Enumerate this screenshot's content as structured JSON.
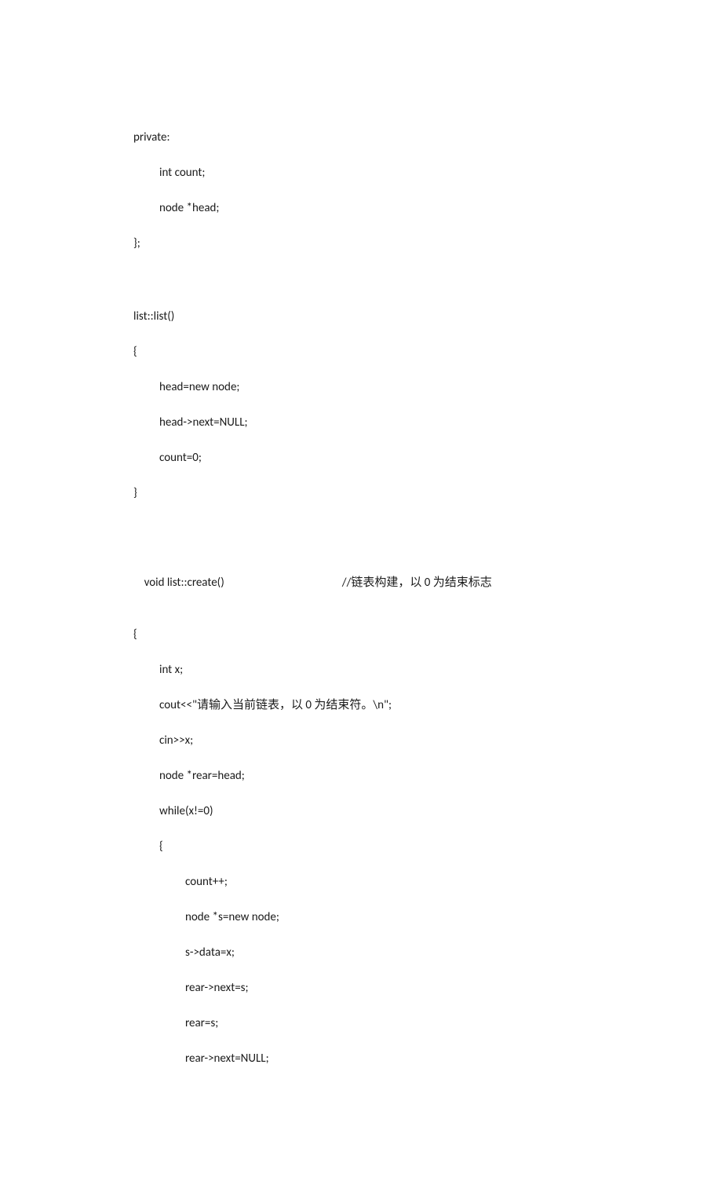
{
  "code": {
    "l1": "private:",
    "l2": "int count;",
    "l3": "node *head;",
    "l4": "};",
    "l5": "list::list()",
    "l6": "{",
    "l7": "head=new node;",
    "l8": "head->next=NULL;",
    "l9": "count=0;",
    "l10": "}",
    "l11a": "void list::create()",
    "l11b": "//链表构建，以 0 为结束标志",
    "l12": "{",
    "l13": "int x;",
    "l14": "cout<<\"请输入当前链表，以 0 为结束符。\\n\";",
    "l15": "cin>>x;",
    "l16": "node *rear=head;",
    "l17": "while(x!=0)",
    "l18": "{",
    "l19": "count++;",
    "l20": "node *s=new node;",
    "l21": "s->data=x;",
    "l22": "rear->next=s;",
    "l23": "rear=s;",
    "l24": "rear->next=NULL;"
  }
}
